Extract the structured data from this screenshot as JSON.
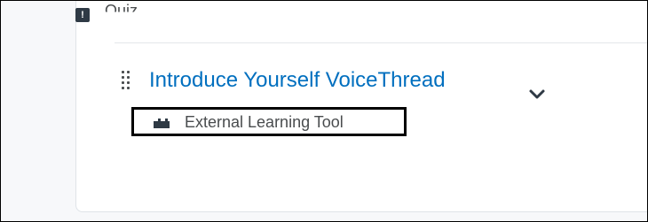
{
  "content_list": {
    "previous_item": {
      "icon": "quiz-icon",
      "label": "Quiz"
    },
    "current_item": {
      "drag_icon": "drag-handle-icon",
      "title": "Introduce Yourself VoiceThread",
      "type_icon": "puzzle-piece-icon",
      "type_label": "External Learning Tool",
      "expand_icon": "chevron-down-icon"
    }
  },
  "colors": {
    "link": "#006fbf",
    "text": "#494c4e",
    "divider": "#e3e6ea"
  }
}
